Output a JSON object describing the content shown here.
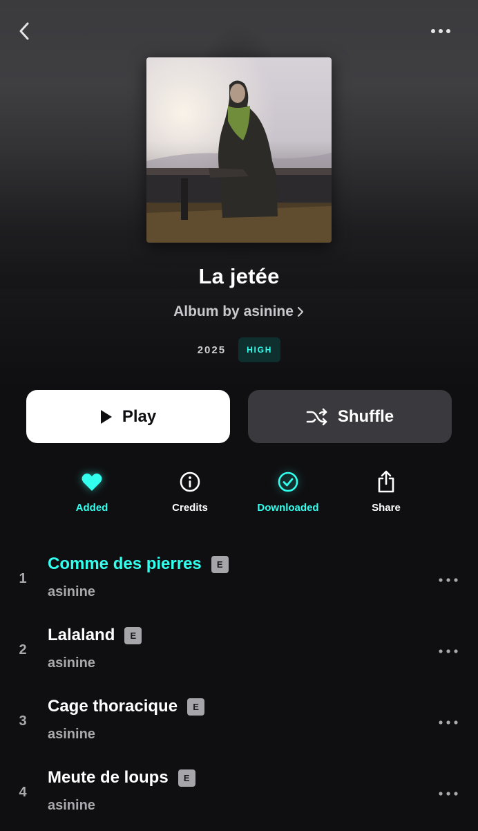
{
  "header": {
    "back_icon": "chevron-left-icon",
    "more_icon": "more-horizontal-icon"
  },
  "album": {
    "title": "La jetée",
    "subtitle": "Album by asinine",
    "year": "2025",
    "quality": "HIGH"
  },
  "buttons": {
    "play_label": "Play",
    "shuffle_label": "Shuffle"
  },
  "actions": [
    {
      "label": "Added",
      "icon": "heart-icon",
      "active": true
    },
    {
      "label": "Credits",
      "icon": "info-icon",
      "active": false
    },
    {
      "label": "Downloaded",
      "icon": "check-circle-icon",
      "active": true
    },
    {
      "label": "Share",
      "icon": "share-icon",
      "active": false
    }
  ],
  "tracks": [
    {
      "number": "1",
      "title": "Comme des pierres",
      "explicit": "E",
      "artist": "asinine",
      "playing": true
    },
    {
      "number": "2",
      "title": "Lalaland",
      "explicit": "E",
      "artist": "asinine",
      "playing": false
    },
    {
      "number": "3",
      "title": "Cage thoracique",
      "explicit": "E",
      "artist": "asinine",
      "playing": false
    },
    {
      "number": "4",
      "title": "Meute de loups",
      "explicit": "E",
      "artist": "asinine",
      "playing": false
    }
  ],
  "colors": {
    "accent": "#33ffee",
    "background": "#0f0f11",
    "secondary_text": "#a9a9ae",
    "shuffle_bg": "#3a3a3e"
  }
}
